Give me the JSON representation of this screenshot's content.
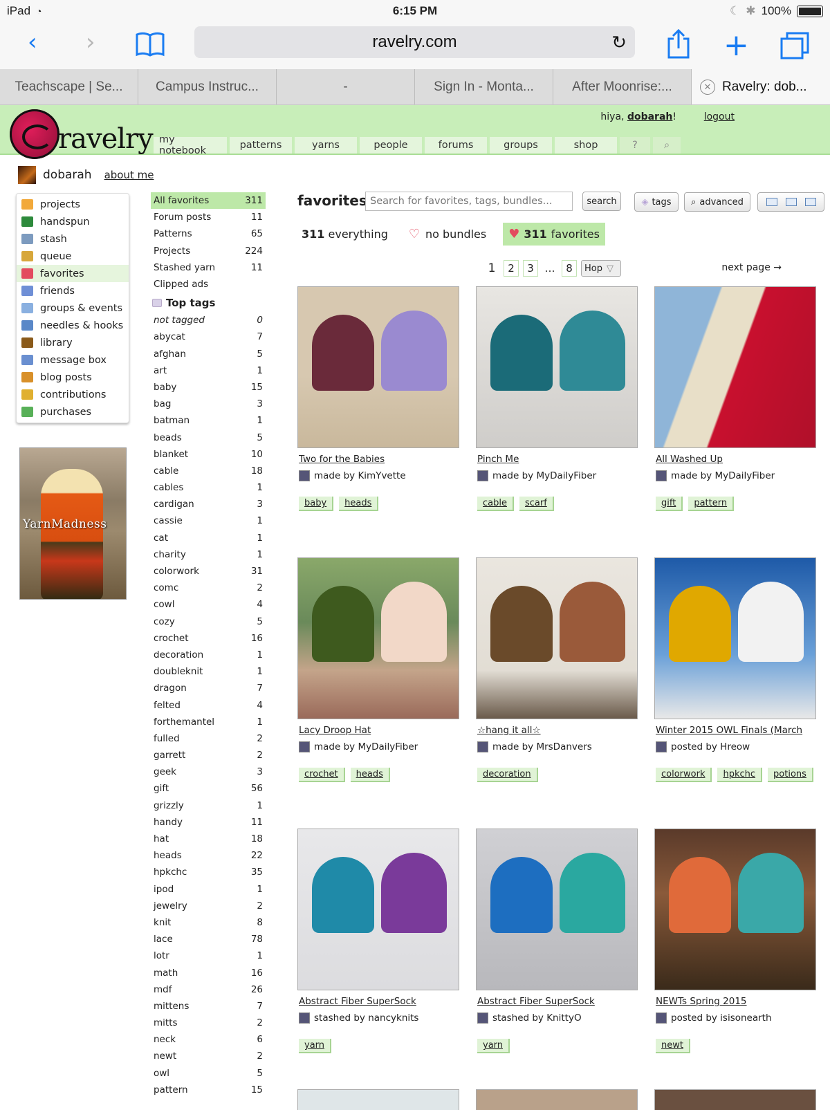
{
  "status": {
    "device": "iPad",
    "time": "6:15 PM",
    "battery": "100%"
  },
  "browser": {
    "url": "ravelry.com",
    "tabs": [
      "Teachscape | Se...",
      "Campus Instruc...",
      "-",
      "Sign In - Monta...",
      "After Moonrise:...",
      "Ravelry: dob..."
    ]
  },
  "header": {
    "logo": "ravelry",
    "greeting": "hiya,",
    "username": "dobarah",
    "logout": "logout",
    "nav": [
      "my notebook",
      "patterns",
      "yarns",
      "people",
      "forums",
      "groups",
      "shop"
    ]
  },
  "profile": {
    "name": "dobarah",
    "about": "about me",
    "picture_text": "YarnMadness"
  },
  "sidemenu": [
    {
      "label": "projects",
      "color": "#f2a93b"
    },
    {
      "label": "handspun",
      "color": "#2d8a3c"
    },
    {
      "label": "stash",
      "color": "#7d9bbf"
    },
    {
      "label": "queue",
      "color": "#d7a73b"
    },
    {
      "label": "favorites",
      "color": "#e34b5f"
    },
    {
      "label": "friends",
      "color": "#6f8fd6"
    },
    {
      "label": "groups & events",
      "color": "#8ab0e0"
    },
    {
      "label": "needles & hooks",
      "color": "#5a88c8"
    },
    {
      "label": "library",
      "color": "#8a5a1a"
    },
    {
      "label": "message box",
      "color": "#6a8fd0"
    },
    {
      "label": "blog posts",
      "color": "#d8902a"
    },
    {
      "label": "contributions",
      "color": "#e0b030"
    },
    {
      "label": "purchases",
      "color": "#58b058"
    }
  ],
  "favcats": [
    {
      "label": "All favorites",
      "count": "311"
    },
    {
      "label": "Forum posts",
      "count": "11"
    },
    {
      "label": "Patterns",
      "count": "65"
    },
    {
      "label": "Projects",
      "count": "224"
    },
    {
      "label": "Stashed yarn",
      "count": "11"
    },
    {
      "label": "Clipped ads",
      "count": ""
    }
  ],
  "toptags_heading": "Top tags",
  "tags": [
    {
      "label": "not tagged",
      "count": "0"
    },
    {
      "label": "abycat",
      "count": "7"
    },
    {
      "label": "afghan",
      "count": "5"
    },
    {
      "label": "art",
      "count": "1"
    },
    {
      "label": "baby",
      "count": "15"
    },
    {
      "label": "bag",
      "count": "3"
    },
    {
      "label": "batman",
      "count": "1"
    },
    {
      "label": "beads",
      "count": "5"
    },
    {
      "label": "blanket",
      "count": "10"
    },
    {
      "label": "cable",
      "count": "18"
    },
    {
      "label": "cables",
      "count": "1"
    },
    {
      "label": "cardigan",
      "count": "3"
    },
    {
      "label": "cassie",
      "count": "1"
    },
    {
      "label": "cat",
      "count": "1"
    },
    {
      "label": "charity",
      "count": "1"
    },
    {
      "label": "colorwork",
      "count": "31"
    },
    {
      "label": "comc",
      "count": "2"
    },
    {
      "label": "cowl",
      "count": "4"
    },
    {
      "label": "cozy",
      "count": "5"
    },
    {
      "label": "crochet",
      "count": "16"
    },
    {
      "label": "decoration",
      "count": "1"
    },
    {
      "label": "doubleknit",
      "count": "1"
    },
    {
      "label": "dragon",
      "count": "7"
    },
    {
      "label": "felted",
      "count": "4"
    },
    {
      "label": "forthemantel",
      "count": "1"
    },
    {
      "label": "fulled",
      "count": "2"
    },
    {
      "label": "garrett",
      "count": "2"
    },
    {
      "label": "geek",
      "count": "3"
    },
    {
      "label": "gift",
      "count": "56"
    },
    {
      "label": "grizzly",
      "count": "1"
    },
    {
      "label": "handy",
      "count": "11"
    },
    {
      "label": "hat",
      "count": "18"
    },
    {
      "label": "heads",
      "count": "22"
    },
    {
      "label": "hpkchc",
      "count": "35"
    },
    {
      "label": "ipod",
      "count": "1"
    },
    {
      "label": "jewelry",
      "count": "2"
    },
    {
      "label": "knit",
      "count": "8"
    },
    {
      "label": "lace",
      "count": "78"
    },
    {
      "label": "lotr",
      "count": "1"
    },
    {
      "label": "math",
      "count": "16"
    },
    {
      "label": "mdf",
      "count": "26"
    },
    {
      "label": "mittens",
      "count": "7"
    },
    {
      "label": "mitts",
      "count": "2"
    },
    {
      "label": "neck",
      "count": "6"
    },
    {
      "label": "newt",
      "count": "2"
    },
    {
      "label": "owl",
      "count": "5"
    },
    {
      "label": "pattern",
      "count": "15"
    }
  ],
  "main": {
    "title": "favorites",
    "search_placeholder": "Search for favorites, tags, bundles...",
    "search_btn": "search",
    "tags_btn": "tags",
    "advanced_btn": "advanced",
    "filter_all_count": "311",
    "filter_all_label": "everything",
    "filter_nobundles": "no bundles",
    "filter_fav_count": "311",
    "filter_fav_label": "favorites",
    "pages": [
      "1",
      "2",
      "3",
      "…",
      "8"
    ],
    "page_select": "Hop",
    "next_page": "next page →"
  },
  "cards": [
    {
      "title": "Two for the Babies",
      "by": "made by KimYvette",
      "tags": [
        "baby",
        "heads"
      ],
      "bg": "linear-gradient(180deg,#d7c8b0 0%,#d7c8b0 55%,#c9b89c 100%)",
      "c1": "#6a2a3a",
      "c2": "#9a8ad0"
    },
    {
      "title": "Pinch Me",
      "by": "made by MyDailyFiber",
      "tags": [
        "cable",
        "scarf"
      ],
      "bg": "linear-gradient(180deg,#e8e6e2,#cfcdca)",
      "c1": "#1b6b78",
      "c2": "#2f8a96"
    },
    {
      "title": "All Washed Up",
      "by": "made by MyDailyFiber",
      "tags": [
        "gift",
        "pattern"
      ],
      "bg": "linear-gradient(110deg,#8fb5d8 0%,#8fb5d8 30%,#e8dfc8 31%,#e8dfc8 50%,#c8102e 51%,#b0102a 100%)",
      "c1": "",
      "c2": ""
    },
    {
      "title": "Lacy Droop Hat",
      "by": "made by MyDailyFiber",
      "tags": [
        "crochet",
        "heads"
      ],
      "bg": "linear-gradient(180deg,#8aa86a 0%,#6a8a5a 40%,#c4a48a 70%,#9a6a5a 100%)",
      "c1": "#3e5a1e",
      "c2": "#f2d8c8"
    },
    {
      "title": "☆hang it all☆",
      "by": "made by MrsDanvers",
      "tags": [
        "decoration"
      ],
      "bg": "linear-gradient(180deg,#eae6df 0%,#e2ddd4 70%,#6a5a4a 100%)",
      "c1": "#6a4a2a",
      "c2": "#9a5a3a"
    },
    {
      "title": "Winter 2015 OWL Finals (March",
      "by": "posted by Hreow",
      "tags": [
        "colorwork",
        "hpkchc",
        "potions"
      ],
      "bg": "linear-gradient(180deg,#1e5aa8,#6aa0d8 60%,#e8e8e8)",
      "c1": "#e0a800",
      "c2": "#f2f2f2"
    },
    {
      "title": "Abstract Fiber SuperSock",
      "by": "stashed by nancyknits",
      "tags": [
        "yarn"
      ],
      "bg": "linear-gradient(180deg,#e8e8ea,#dcdcdf)",
      "c1": "#1f8aa8",
      "c2": "#7a3a9a"
    },
    {
      "title": "Abstract Fiber SuperSock",
      "by": "stashed by KnittyO",
      "tags": [
        "yarn"
      ],
      "bg": "linear-gradient(180deg,#d0d0d4,#b8b8bc)",
      "c1": "#1d6ec0",
      "c2": "#2aa8a0"
    },
    {
      "title": "NEWTs Spring 2015",
      "by": "posted by isisonearth",
      "tags": [
        "newt"
      ],
      "bg": "linear-gradient(180deg,#5a3a2a,#8a5a3a 40%,#3a2a1a)",
      "c1": "#e06a3a",
      "c2": "#3aa8a8"
    }
  ]
}
